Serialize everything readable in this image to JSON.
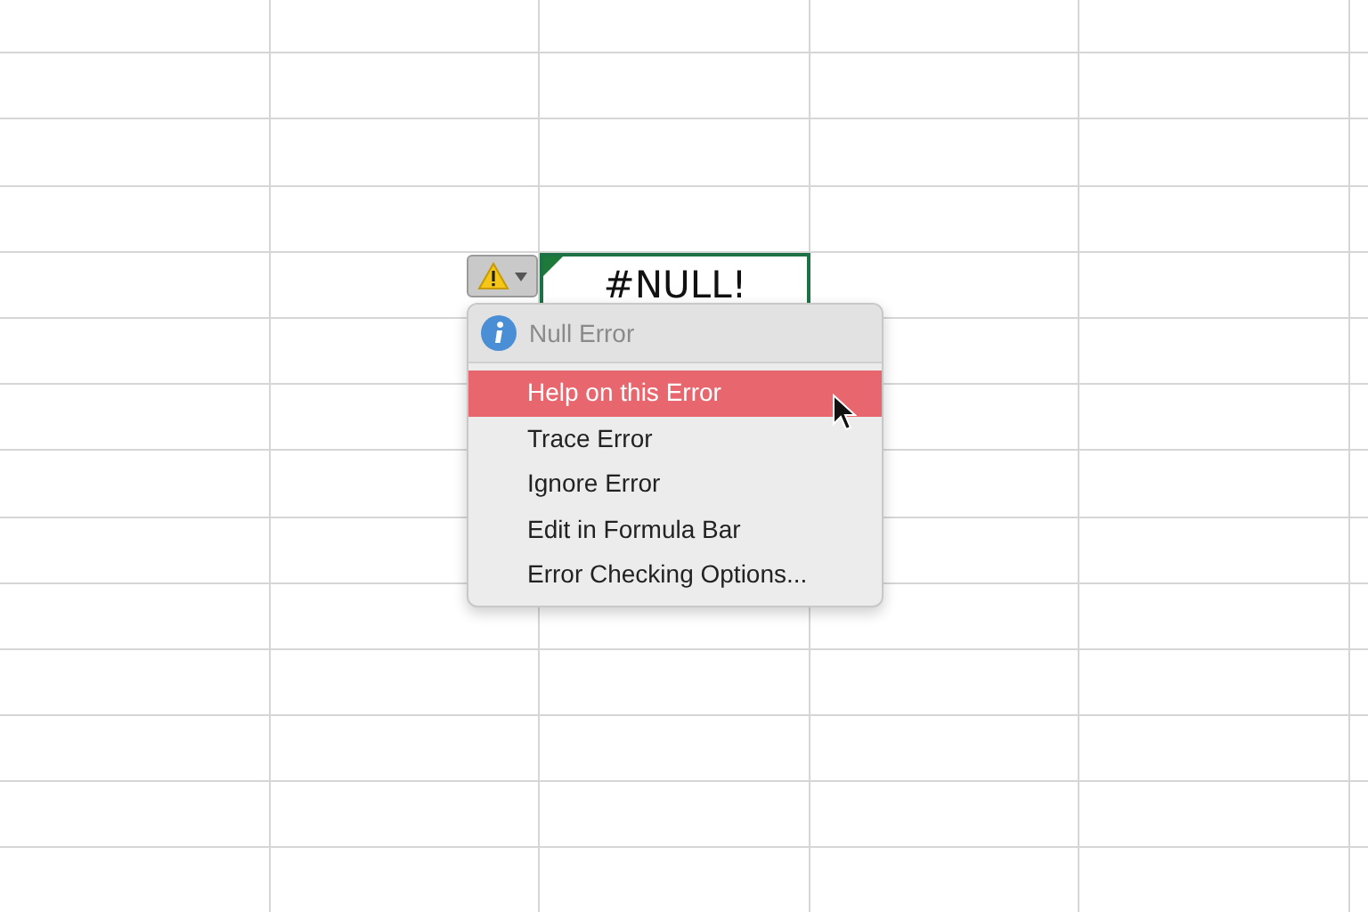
{
  "cell": {
    "value": "#NULL!",
    "selected": true,
    "error_marker": true
  },
  "error_button": {
    "open": true
  },
  "menu": {
    "header": {
      "label": "Null Error",
      "disabled": true
    },
    "items": [
      {
        "label": "Help on this Error",
        "selected": true
      },
      {
        "label": "Trace Error",
        "selected": false
      },
      {
        "label": "Ignore Error",
        "selected": false
      },
      {
        "label": "Edit in Formula Bar",
        "selected": false
      },
      {
        "label": "Error Checking Options...",
        "selected": false
      }
    ]
  }
}
